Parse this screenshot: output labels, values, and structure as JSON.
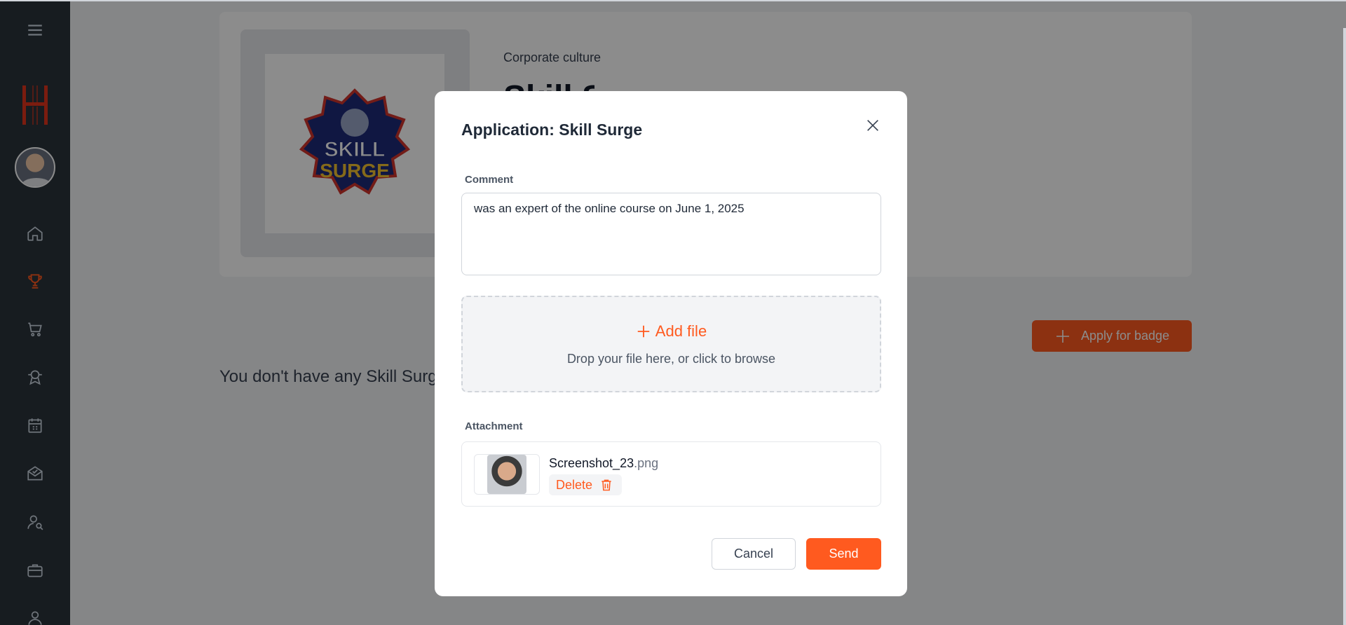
{
  "colors": {
    "accent": "#ff5a1f",
    "sidebar_bg": "#2b333b",
    "overlay": "rgba(0,0,0,0.45)"
  },
  "sidebar": {
    "items": [
      {
        "icon": "menu-icon"
      },
      {
        "icon": "logo-icon"
      },
      {
        "icon": "avatar"
      },
      {
        "icon": "home-icon"
      },
      {
        "icon": "trophy-icon",
        "active": true
      },
      {
        "icon": "cart-icon"
      },
      {
        "icon": "award-icon"
      },
      {
        "icon": "calendar-icon"
      },
      {
        "icon": "mail-check-icon"
      },
      {
        "icon": "user-search-icon"
      },
      {
        "icon": "briefcase-icon"
      },
      {
        "icon": "user-icon"
      }
    ]
  },
  "page": {
    "category": "Corporate culture",
    "title": "Skill Surge",
    "apply_label": "Apply for badge",
    "empty_message": "You don't have any Skill Surge",
    "badge_logo_text_top": "SKILL",
    "badge_logo_text_bottom": "SURGE"
  },
  "modal": {
    "title": "Application: Skill Surge",
    "comment_label": "Comment",
    "comment_value": "was an expert of the online course on June 1, 2025",
    "add_file_label": "Add file",
    "drop_hint": "Drop your file here, or click to browse",
    "attachment_label": "Attachment",
    "attachment": {
      "file_base": "Screenshot_23",
      "file_ext": ".png",
      "delete_label": "Delete"
    },
    "cancel_label": "Cancel",
    "send_label": "Send"
  }
}
